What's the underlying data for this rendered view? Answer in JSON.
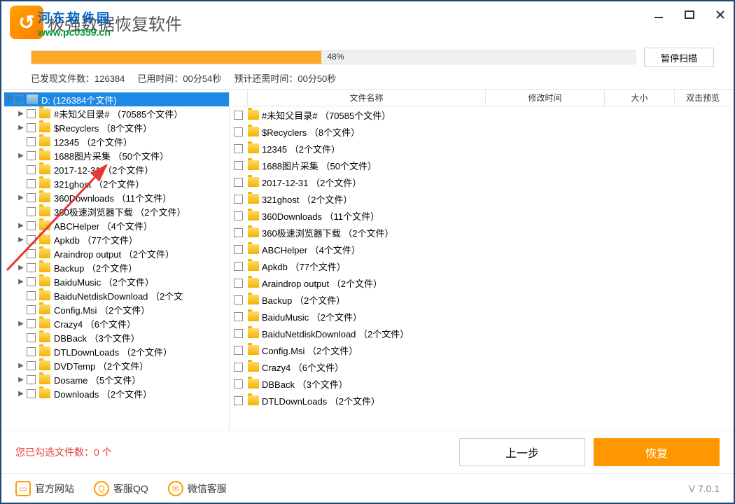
{
  "title": "极强数据恢复软件",
  "watermark": {
    "line1": "河东软件园",
    "line2": "www.pc0359.cn"
  },
  "progress": {
    "percent": "48%",
    "pause": "暂停扫描"
  },
  "status": {
    "found_label": "已发现文件数：",
    "found_count": "126384",
    "elapsed_label": "已用时间：",
    "elapsed": "00分54秒",
    "remain_label": "预计还需时间：",
    "remain": "00分50秒"
  },
  "tree": {
    "root_label": "D:   (126384个文件)",
    "items": [
      {
        "name": "#未知父目录#",
        "count": "（70585个文件）",
        "exp": "▶"
      },
      {
        "name": "$Recyclers",
        "count": "（8个文件）",
        "exp": "▶"
      },
      {
        "name": "12345",
        "count": "（2个文件）",
        "exp": ""
      },
      {
        "name": "1688图片采集",
        "count": "（50个文件）",
        "exp": "▶"
      },
      {
        "name": "2017-12-31",
        "count": "（2个文件）",
        "exp": ""
      },
      {
        "name": "321ghost",
        "count": "（2个文件）",
        "exp": ""
      },
      {
        "name": "360Downloads",
        "count": "（11个文件）",
        "exp": "▶"
      },
      {
        "name": "360极速浏览器下载",
        "count": "（2个文件）",
        "exp": ""
      },
      {
        "name": "ABCHelper",
        "count": "（4个文件）",
        "exp": "▶"
      },
      {
        "name": "Apkdb",
        "count": "（77个文件）",
        "exp": "▶"
      },
      {
        "name": "Araindrop output",
        "count": "（2个文件）",
        "exp": ""
      },
      {
        "name": "Backup",
        "count": "（2个文件）",
        "exp": "▶"
      },
      {
        "name": "BaiduMusic",
        "count": "（2个文件）",
        "exp": "▶"
      },
      {
        "name": "BaiduNetdiskDownload",
        "count": "（2个文",
        "exp": ""
      },
      {
        "name": "Config.Msi",
        "count": "（2个文件）",
        "exp": ""
      },
      {
        "name": "Crazy4",
        "count": "（6个文件）",
        "exp": "▶"
      },
      {
        "name": "DBBack",
        "count": "（3个文件）",
        "exp": ""
      },
      {
        "name": "DTLDownLoads",
        "count": "（2个文件）",
        "exp": ""
      },
      {
        "name": "DVDTemp",
        "count": "（2个文件）",
        "exp": "▶"
      },
      {
        "name": "Dosame",
        "count": "（5个文件）",
        "exp": "▶"
      },
      {
        "name": "Downloads",
        "count": "（2个文件）",
        "exp": "▶"
      }
    ]
  },
  "list": {
    "headers": {
      "name": "文件名称",
      "date": "修改时间",
      "size": "大小",
      "preview": "双击预览"
    },
    "rows": [
      {
        "name": "#未知父目录#",
        "count": "（70585个文件）"
      },
      {
        "name": "$Recyclers",
        "count": "（8个文件）"
      },
      {
        "name": "12345",
        "count": "（2个文件）"
      },
      {
        "name": "1688图片采集",
        "count": "（50个文件）"
      },
      {
        "name": "2017-12-31",
        "count": "（2个文件）"
      },
      {
        "name": "321ghost",
        "count": "（2个文件）"
      },
      {
        "name": "360Downloads",
        "count": "（11个文件）"
      },
      {
        "name": "360极速浏览器下载",
        "count": "（2个文件）"
      },
      {
        "name": "ABCHelper",
        "count": "（4个文件）"
      },
      {
        "name": "Apkdb",
        "count": "（77个文件）"
      },
      {
        "name": "Araindrop output",
        "count": "（2个文件）"
      },
      {
        "name": "Backup",
        "count": "（2个文件）"
      },
      {
        "name": "BaiduMusic",
        "count": "（2个文件）"
      },
      {
        "name": "BaiduNetdiskDownload",
        "count": "（2个文件）"
      },
      {
        "name": "Config.Msi",
        "count": "（2个文件）"
      },
      {
        "name": "Crazy4",
        "count": "（6个文件）"
      },
      {
        "name": "DBBack",
        "count": "（3个文件）"
      },
      {
        "name": "DTLDownLoads",
        "count": "（2个文件）"
      }
    ]
  },
  "selected": {
    "label": "您已勾选文件数：",
    "count": "0 个"
  },
  "buttons": {
    "prev": "上一步",
    "recover": "恢复"
  },
  "footer": {
    "site": "官方网站",
    "qq": "客服QQ",
    "wechat": "微信客服",
    "version": "V 7.0.1"
  }
}
